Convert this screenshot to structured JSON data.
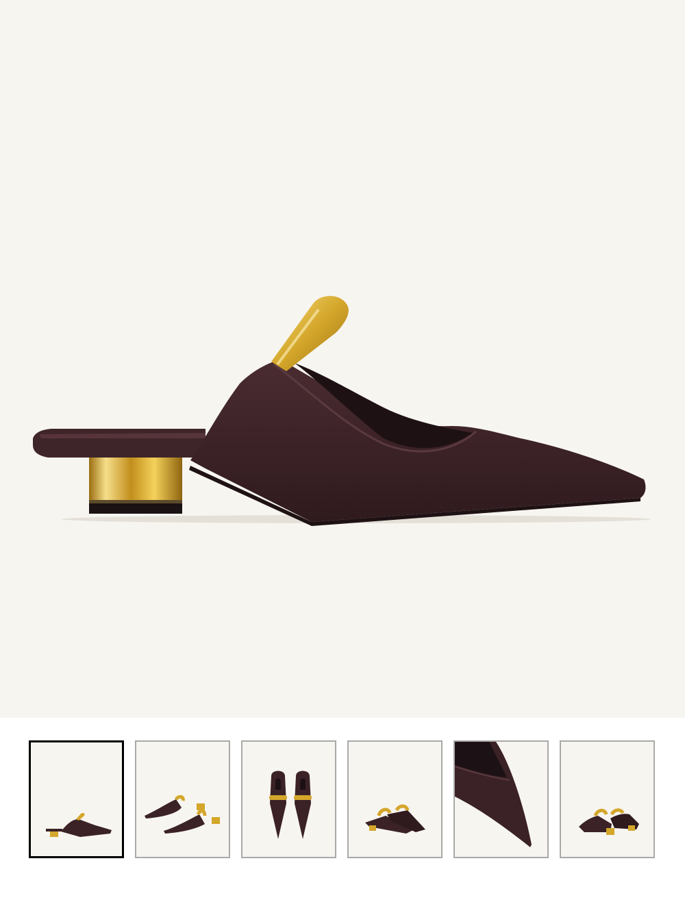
{
  "product": {
    "main_image": {
      "alt": "",
      "background": "#f7f5f0",
      "leather_color": "#3b2226",
      "gold_color": "#d9b441"
    }
  },
  "gallery": {
    "selected_index": 0,
    "thumbnails": [
      {
        "view": "side"
      },
      {
        "view": "pair-angled"
      },
      {
        "view": "top-pair"
      },
      {
        "view": "front-pair"
      },
      {
        "view": "toe-closeup"
      },
      {
        "view": "back-pair"
      }
    ]
  }
}
